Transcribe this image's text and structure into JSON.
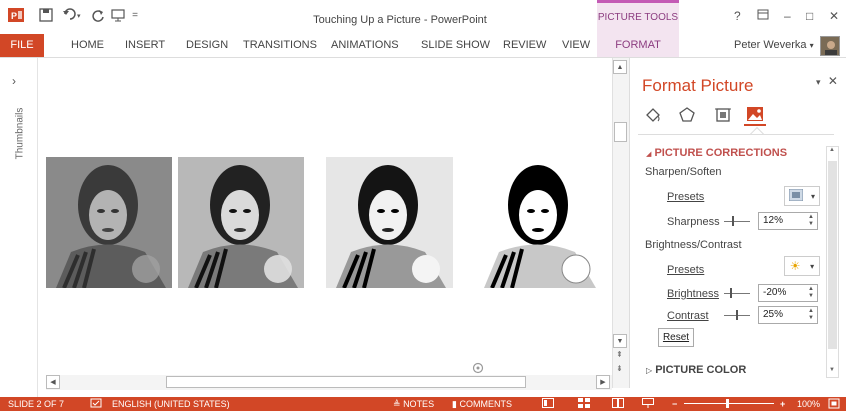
{
  "window": {
    "title": "Touching Up a Picture - PowerPoint",
    "context_tab_group": "PICTURE TOOLS",
    "help": "?",
    "minimize": "–",
    "maximize": "□",
    "close": "✕"
  },
  "ribbon": {
    "tabs": [
      "FILE",
      "HOME",
      "INSERT",
      "DESIGN",
      "TRANSITIONS",
      "ANIMATIONS",
      "SLIDE SHOW",
      "REVIEW",
      "VIEW",
      "FORMAT"
    ],
    "user": "Peter Weverka"
  },
  "thumbnails": {
    "label": "Thumbnails",
    "expand": "›"
  },
  "format_pane": {
    "title": "Format Picture",
    "sections": {
      "corrections": "PICTURE CORRECTIONS",
      "color": "PICTURE COLOR"
    },
    "sharpen_soften": "Sharpen/Soften",
    "presets_label_1": "Presets",
    "sharpness_label": "Sharpness",
    "sharpness_value": "12%",
    "brightness_contrast": "Brightness/Contrast",
    "presets_label_2": "Presets",
    "brightness_label": "Brightness",
    "brightness_value": "-20%",
    "contrast_label": "Contrast",
    "contrast_value": "25%",
    "reset_label": "Reset",
    "section_open_marker": "◢",
    "section_closed_marker": "▷"
  },
  "status_bar": {
    "slide": "SLIDE 2 OF 7",
    "language": "ENGLISH (UNITED STATES)",
    "notes": "NOTES",
    "comments": "COMMENTS",
    "zoom": "100%",
    "color": "#d24726"
  },
  "colors": {
    "accent": "#d24726",
    "context_tab": "#c45ab5"
  }
}
